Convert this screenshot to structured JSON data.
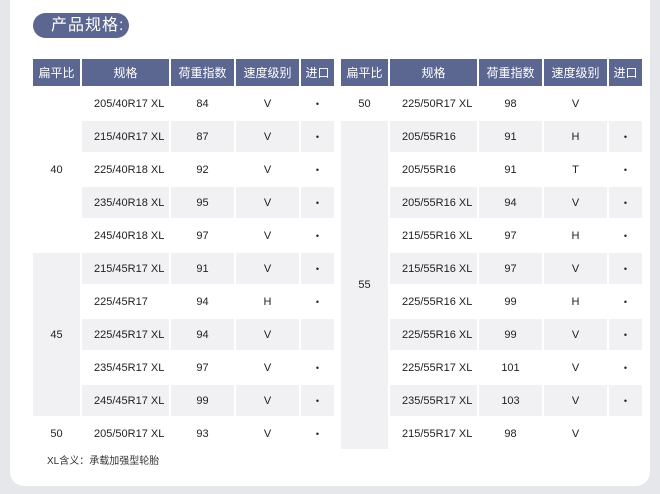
{
  "title": "产品规格:",
  "headers": [
    "扁平比",
    "规格",
    "荷重指数",
    "速度级别",
    "进口"
  ],
  "left_rows": [
    {
      "spec": "205/40R17 XL",
      "load": "84",
      "speed": "V",
      "import": "•"
    },
    {
      "spec": "215/40R17 XL",
      "load": "87",
      "speed": "V",
      "import": "•"
    },
    {
      "spec": "225/40R18 XL",
      "load": "92",
      "speed": "V",
      "import": "•"
    },
    {
      "spec": "235/40R18 XL",
      "load": "95",
      "speed": "V",
      "import": "•"
    },
    {
      "spec": "245/40R18 XL",
      "load": "97",
      "speed": "V",
      "import": "•"
    },
    {
      "spec": "215/45R17 XL",
      "load": "91",
      "speed": "V",
      "import": "•"
    },
    {
      "spec": "225/45R17",
      "load": "94",
      "speed": "H",
      "import": "•"
    },
    {
      "spec": "225/45R17 XL",
      "load": "94",
      "speed": "V",
      "import": ""
    },
    {
      "spec": "235/45R17 XL",
      "load": "97",
      "speed": "V",
      "import": "•"
    },
    {
      "spec": "245/45R17 XL",
      "load": "99",
      "speed": "V",
      "import": "•"
    },
    {
      "spec": "205/50R17 XL",
      "load": "93",
      "speed": "V",
      "import": "•"
    }
  ],
  "left_ratios": [
    "40",
    "45",
    "50"
  ],
  "right_rows": [
    {
      "spec": "225/50R17 XL",
      "load": "98",
      "speed": "V",
      "import": ""
    },
    {
      "spec": "205/55R16",
      "load": "91",
      "speed": "H",
      "import": "•"
    },
    {
      "spec": "205/55R16",
      "load": "91",
      "speed": "T",
      "import": "•"
    },
    {
      "spec": "205/55R16 XL",
      "load": "94",
      "speed": "V",
      "import": "•"
    },
    {
      "spec": "215/55R16 XL",
      "load": "97",
      "speed": "H",
      "import": "•"
    },
    {
      "spec": "215/55R16 XL",
      "load": "97",
      "speed": "V",
      "import": "•"
    },
    {
      "spec": "225/55R16 XL",
      "load": "99",
      "speed": "H",
      "import": "•"
    },
    {
      "spec": "225/55R16 XL",
      "load": "99",
      "speed": "V",
      "import": "•"
    },
    {
      "spec": "225/55R17 XL",
      "load": "101",
      "speed": "V",
      "import": "•"
    },
    {
      "spec": "235/55R17 XL",
      "load": "103",
      "speed": "V",
      "import": "•"
    },
    {
      "spec": "215/55R17 XL",
      "load": "98",
      "speed": "V",
      "import": ""
    }
  ],
  "right_ratios": [
    "50",
    "55"
  ],
  "note": "XL含义：承载加强型轮胎"
}
